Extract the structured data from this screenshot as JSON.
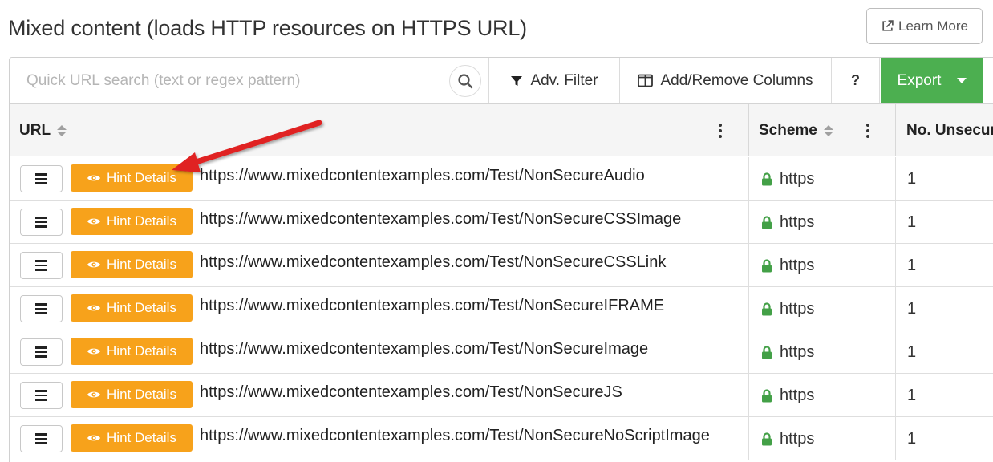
{
  "page": {
    "title": "Mixed content (loads HTTP resources on HTTPS URL)",
    "learn_more_label": "Learn More"
  },
  "toolbar": {
    "search_placeholder": "Quick URL search (text or regex pattern)",
    "search_value": "",
    "filter_label": "Adv. Filter",
    "columns_label": "Add/Remove Columns",
    "help_label": "?",
    "export_label": "Export"
  },
  "table": {
    "columns": [
      "URL",
      "Scheme",
      "No. Unsecure"
    ],
    "hint_label": "Hint Details",
    "rows": [
      {
        "url": "https://www.mixedcontentexamples.com/Test/NonSecureAudio",
        "scheme": "https",
        "unsecure": "1"
      },
      {
        "url": "https://www.mixedcontentexamples.com/Test/NonSecureCSSImage",
        "scheme": "https",
        "unsecure": "1"
      },
      {
        "url": "https://www.mixedcontentexamples.com/Test/NonSecureCSSLink",
        "scheme": "https",
        "unsecure": "1"
      },
      {
        "url": "https://www.mixedcontentexamples.com/Test/NonSecureIFRAME",
        "scheme": "https",
        "unsecure": "1"
      },
      {
        "url": "https://www.mixedcontentexamples.com/Test/NonSecureImage",
        "scheme": "https",
        "unsecure": "1"
      },
      {
        "url": "https://www.mixedcontentexamples.com/Test/NonSecureJS",
        "scheme": "https",
        "unsecure": "1"
      },
      {
        "url": "https://www.mixedcontentexamples.com/Test/NonSecureNoScriptImage",
        "scheme": "https",
        "unsecure": "1"
      }
    ]
  },
  "colors": {
    "export_green": "#4caf50",
    "hint_orange": "#f7a21b",
    "lock_green": "#43a047",
    "annotation_arrow_red": "#e02020"
  },
  "icons": {
    "learn_more": "external-link-icon",
    "search": "search-icon",
    "filter": "filter-icon",
    "columns": "columns-icon",
    "row_menu": "hamburger-icon",
    "hint": "eye-icon",
    "scheme": "lock-icon"
  }
}
